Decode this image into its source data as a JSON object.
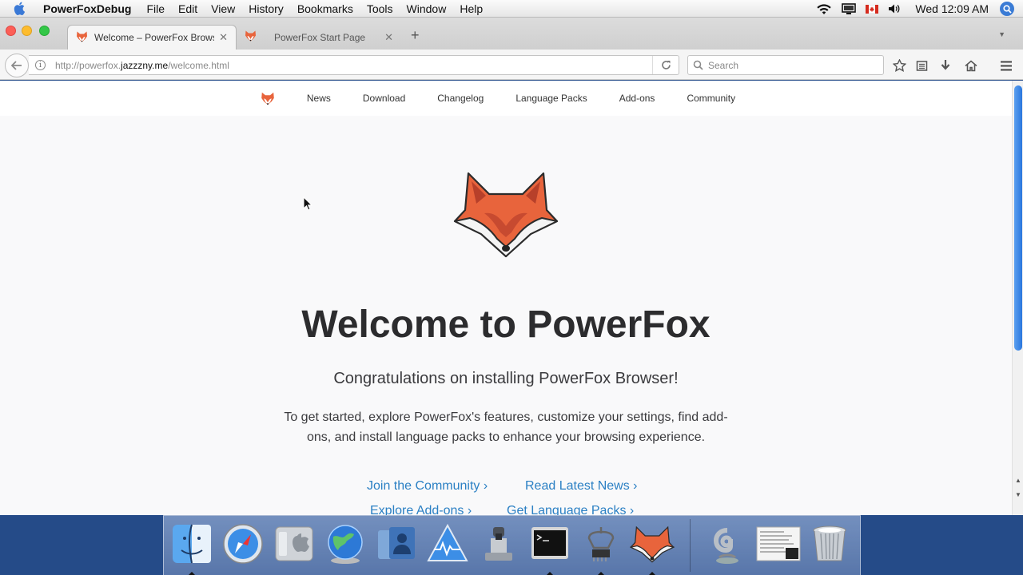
{
  "menubar": {
    "app_name": "PowerFoxDebug",
    "items": [
      "File",
      "Edit",
      "View",
      "History",
      "Bookmarks",
      "Tools",
      "Window",
      "Help"
    ],
    "clock": "Wed 12:09 AM"
  },
  "tabs": [
    {
      "title": "Welcome – PowerFox Browser",
      "active": true
    },
    {
      "title": "PowerFox Start Page",
      "active": false
    }
  ],
  "urlbar": {
    "prefix": "http://powerfox.",
    "domain": "jazzzny.me",
    "path": "/welcome.html"
  },
  "search": {
    "placeholder": "Search"
  },
  "site_nav": {
    "links": [
      "News",
      "Download",
      "Changelog",
      "Language Packs",
      "Add-ons",
      "Community"
    ]
  },
  "hero": {
    "title": "Welcome to PowerFox",
    "subtitle": "Congratulations on installing PowerFox Browser!",
    "description": "To get started, explore PowerFox's features, customize your settings, find add-ons, and install language packs to enhance your browsing experience."
  },
  "ctas": {
    "join": "Join the Community ›",
    "news": "Read Latest News ›",
    "addons": "Explore Add-ons ›",
    "langpacks": "Get Language Packs ›"
  },
  "colors": {
    "accent_link": "#2b80c4",
    "fox_orange": "#e8643c",
    "desktop": "#254b88"
  },
  "dock": {
    "apps": [
      "finder-icon",
      "safari-icon",
      "system-preferences-icon",
      "network-globe-icon",
      "user-accounts-icon",
      "console-warning-icon",
      "preview-icon",
      "terminal-icon",
      "network-utility-icon",
      "powerfox-icon"
    ],
    "right": [
      "mail-icon",
      "document-icon",
      "trash-icon"
    ]
  }
}
